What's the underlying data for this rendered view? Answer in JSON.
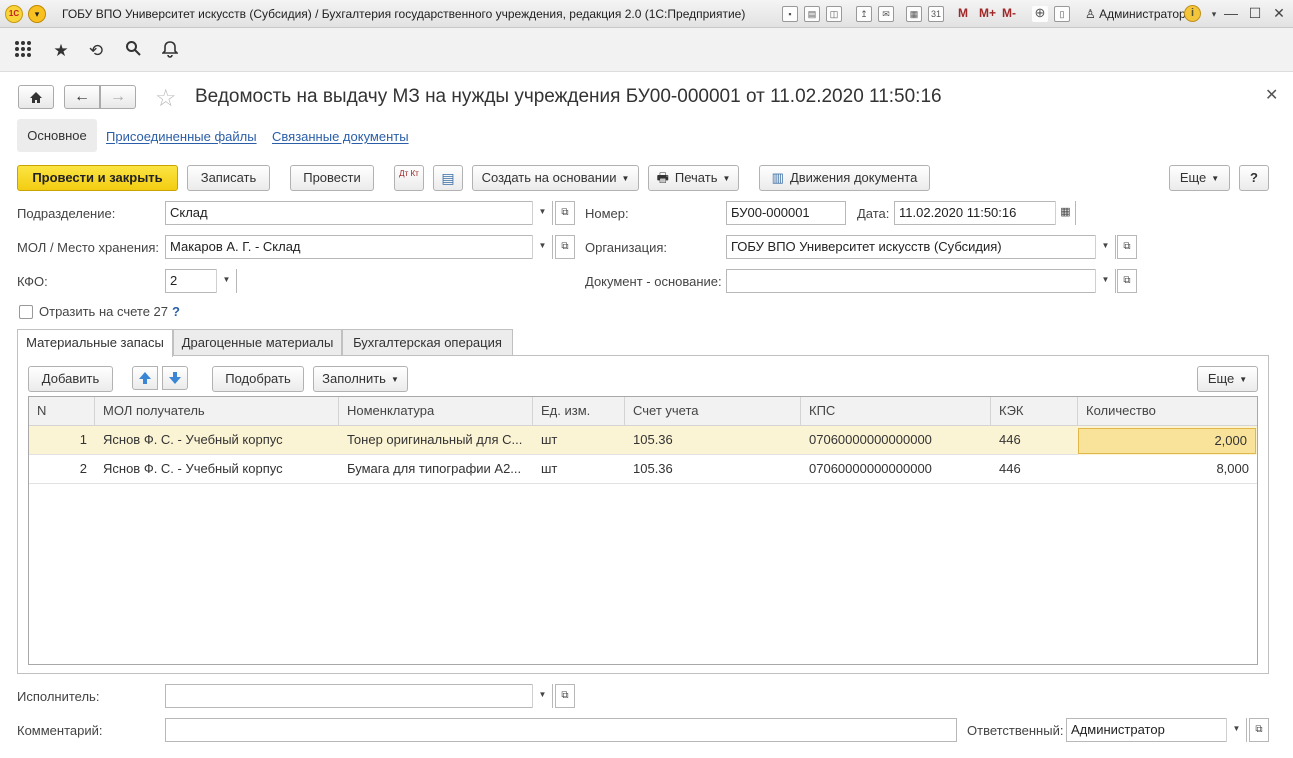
{
  "window": {
    "title": "ГОБУ ВПО Университет искусств (Субсидия) / Бухгалтерия государственного учреждения, редакция 2.0  (1С:Предприятие)",
    "logo": "1С",
    "memory_buttons": [
      "M",
      "M+",
      "M-"
    ],
    "user": "Администратор"
  },
  "document": {
    "title": "Ведомость на выдачу МЗ на нужды учреждения БУ00-000001 от 11.02.2020 11:50:16"
  },
  "tabs": {
    "main": "Основное",
    "files": "Присоединенные файлы",
    "linked": "Связанные документы"
  },
  "commands": {
    "post_close": "Провести и закрыть",
    "save": "Записать",
    "post": "Провести",
    "dt_kt": "Дт Кт",
    "create_based": "Создать на основании",
    "print": "Печать",
    "movements": "Движения документа",
    "more": "Еще",
    "help": "?"
  },
  "fields": {
    "division_label": "Подразделение:",
    "division_value": "Склад",
    "mol_label": "МОЛ / Место хранения:",
    "mol_value": "Макаров А. Г. - Склад",
    "kfo_label": "КФО:",
    "kfo_value": "2",
    "number_label": "Номер:",
    "number_value": "БУ00-000001",
    "date_label": "Дата:",
    "date_value": "11.02.2020 11:50:16",
    "org_label": "Организация:",
    "org_value": "ГОБУ ВПО Университет искусств (Субсидия)",
    "basis_label": "Документ - основание:",
    "basis_value": "",
    "account27_label": "Отразить на счете 27",
    "account27_help": "?"
  },
  "panel_tabs": [
    "Материальные запасы",
    "Драгоценные материалы",
    "Бухгалтерская операция"
  ],
  "table_toolbar": {
    "add": "Добавить",
    "pick": "Подобрать",
    "fill": "Заполнить",
    "more": "Еще"
  },
  "table": {
    "columns": [
      "N",
      "МОЛ получатель",
      "Номенклатура",
      "Ед. изм.",
      "Счет учета",
      "КПС",
      "КЭК",
      "Количество"
    ],
    "rows": [
      [
        "1",
        "Яснов Ф. С. - Учебный корпус",
        "Тонер оригинальный для С...",
        "шт",
        "105.36",
        "07060000000000000",
        "446",
        "2,000"
      ],
      [
        "2",
        "Яснов Ф. С. - Учебный корпус",
        "Бумага для типографии А2...",
        "шт",
        "105.36",
        "07060000000000000",
        "446",
        "8,000"
      ]
    ]
  },
  "footer": {
    "executor_label": "Исполнитель:",
    "executor_value": "",
    "comment_label": "Комментарий:",
    "comment_value": "",
    "responsible_label": "Ответственный:",
    "responsible_value": "Администратор"
  }
}
